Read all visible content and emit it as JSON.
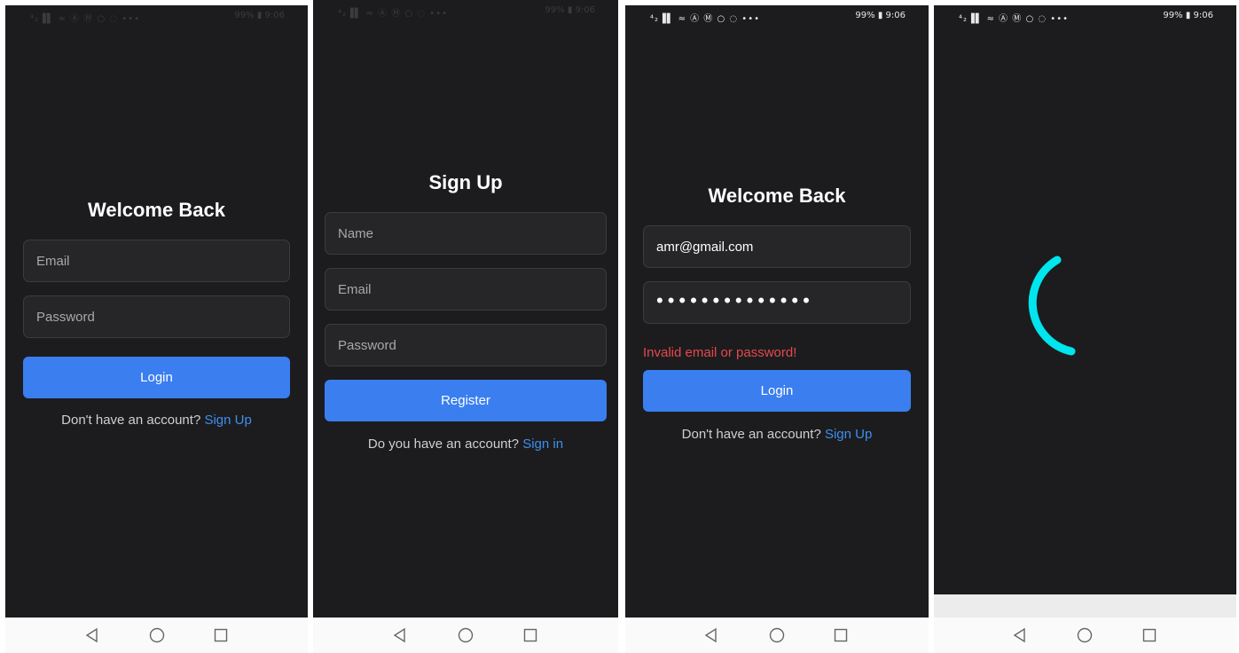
{
  "status_bar": {
    "left_icons": "⁴₂▐▌ ≈ Ⓐ Ⓜ ○ ◌ •••",
    "battery": "99%",
    "time": "9:06"
  },
  "screens": [
    {
      "title": "Welcome Back",
      "email_placeholder": "Email",
      "password_placeholder": "Password",
      "button_label": "Login",
      "prompt": "Don't have an account?",
      "link": "Sign Up"
    },
    {
      "title": "Sign Up",
      "name_placeholder": "Name",
      "email_placeholder": "Email",
      "password_placeholder": "Password",
      "button_label": "Register",
      "prompt": "Do you have an account?",
      "link": "Sign in"
    },
    {
      "title": "Welcome Back",
      "email_value": "amr@gmail.com",
      "password_masked": "••••••••••••••",
      "error": "Invalid email or password!",
      "button_label": "Login",
      "prompt": "Don't have an account?",
      "link": "Sign Up"
    },
    {
      "loading_indicator": "spinner-arc",
      "accent": "#00e5ee"
    }
  ],
  "colors": {
    "background": "#1c1c1e",
    "field": "#262628",
    "button": "#3a7ef0",
    "link": "#3f8ff0",
    "error": "#e5484d"
  },
  "nav": {
    "back_icon": "back-triangle-icon",
    "home_icon": "home-circle-icon",
    "recents_icon": "recents-square-icon"
  }
}
